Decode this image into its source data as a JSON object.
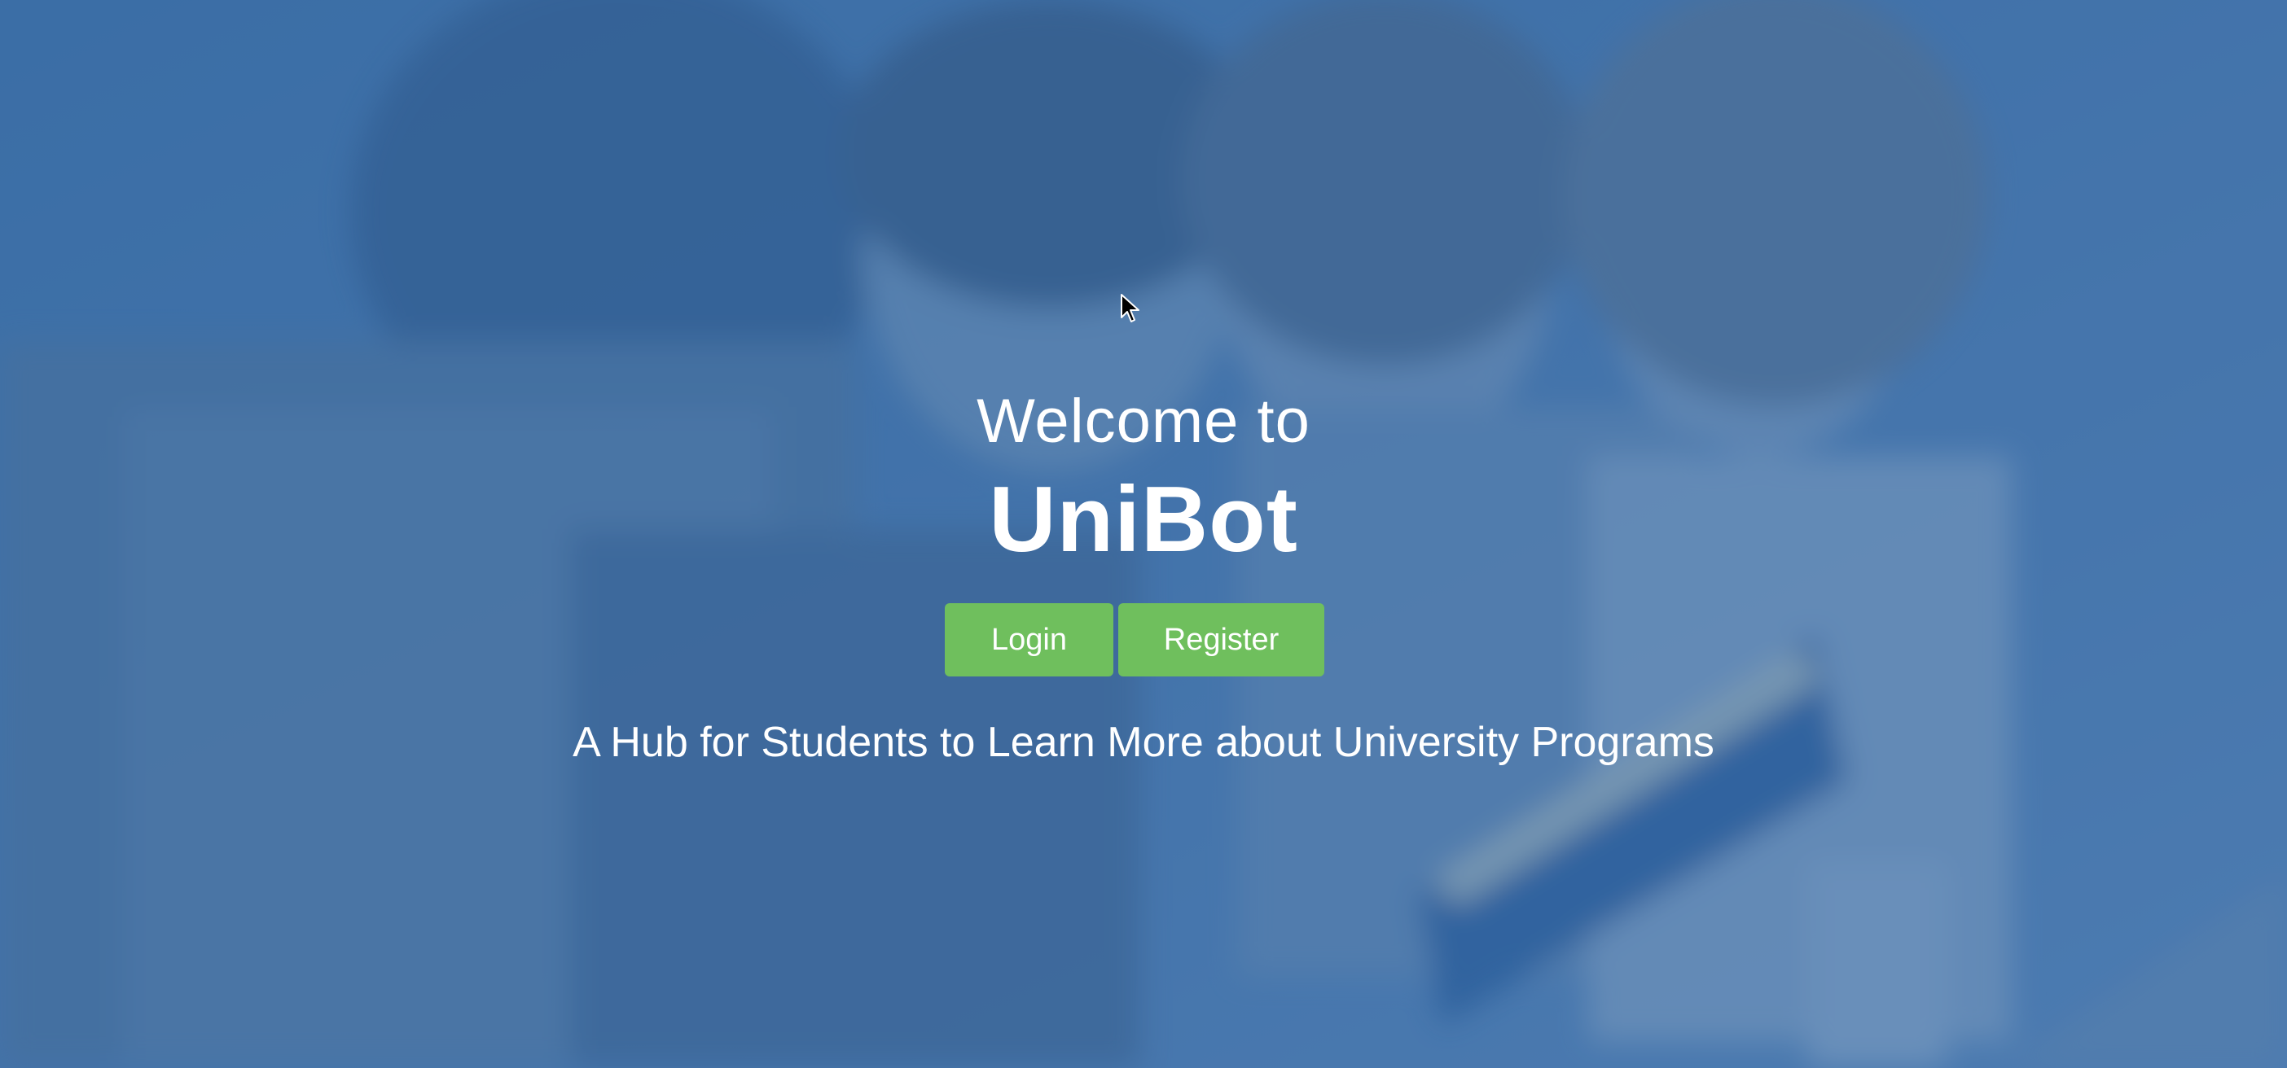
{
  "hero": {
    "background_image": "students-reading-photo",
    "overlay_color": "#3064a2",
    "welcome_text": "Welcome to",
    "brand_name": "UniBot",
    "tagline": "A Hub for Students to Learn More about University Programs"
  },
  "actions": {
    "login_label": "Login",
    "register_label": "Register",
    "button_color": "#6fbf5d"
  }
}
